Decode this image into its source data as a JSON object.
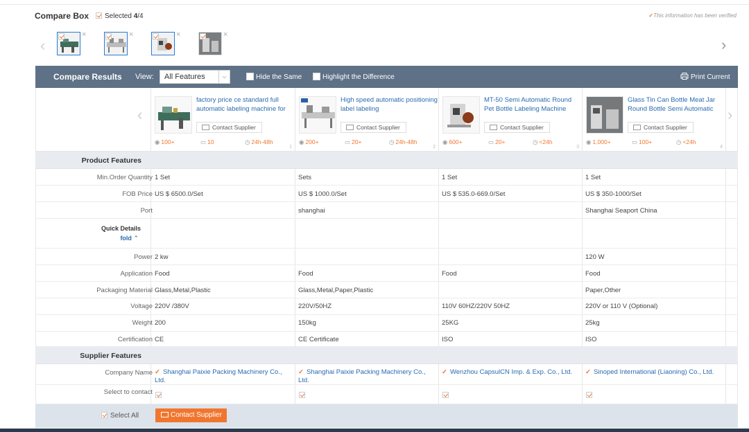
{
  "compare_box": {
    "title": "Compare Box",
    "selected_prefix": "Selected ",
    "selected_count": "4",
    "selected_total": "/4",
    "verified_text": "This information has been verified",
    "thumbs": [
      {
        "close": "×"
      },
      {
        "close": "×"
      },
      {
        "close": "×"
      },
      {
        "close": "×"
      }
    ]
  },
  "toolbar": {
    "title": "Compare Results",
    "view_label": "View:",
    "view_value": "All Features",
    "hide_same": "Hide the Same",
    "highlight_diff": "Highlight the Difference",
    "print": "Print Current"
  },
  "products": [
    {
      "title": "factory price ce standard full automatic labeling machine for",
      "contact": "Contact Supplier",
      "views": "100+",
      "inquiries": "10",
      "response": "24h-48h",
      "num": "1"
    },
    {
      "title": "High speed automatic positioning label labeling",
      "contact": "Contact Supplier",
      "views": "200+",
      "inquiries": "20+",
      "response": "24h-48h",
      "num": "2"
    },
    {
      "title": "MT-50 Semi Automatic Round Pet Bottle Labeling Machine",
      "contact": "Contact Supplier",
      "views": "600+",
      "inquiries": "20+",
      "response": "<24h",
      "num": "3"
    },
    {
      "title": "Glass Tin Can Bottle Meat Jar Round Bottle Semi Automatic",
      "contact": "Contact Supplier",
      "views": "1,000+",
      "inquiries": "100+",
      "response": "<24h",
      "num": "4"
    }
  ],
  "sections": {
    "product_features": "Product Features",
    "supplier_features": "Supplier Features"
  },
  "rows": {
    "moq": {
      "label": "Min.Order Quantity",
      "values": [
        "1 Set",
        "Sets",
        "1 Set",
        "1 Set"
      ]
    },
    "fob": {
      "label": "FOB Price",
      "values": [
        "US $ 6500.0/Set",
        "US $ 1000.0/Set",
        "US $ 535.0-669.0/Set",
        "US $ 350-1000/Set"
      ]
    },
    "port": {
      "label": "Port",
      "values": [
        "",
        "shanghai",
        "",
        "Shanghai Seaport China"
      ]
    },
    "quick_details": {
      "label": "Quick Details",
      "fold": "fold"
    },
    "power": {
      "label": "Power",
      "values": [
        "2 kw",
        "",
        "",
        "120 W"
      ]
    },
    "application": {
      "label": "Application",
      "values": [
        "Food",
        "Food",
        "Food",
        "Food"
      ]
    },
    "packaging": {
      "label": "Packaging Material",
      "values": [
        "Glass,Metal,Plastic",
        "Glass,Metal,Paper,Plastic",
        "",
        "Paper,Other"
      ]
    },
    "voltage": {
      "label": "Voltage",
      "values": [
        "220V /380V",
        "220V/50HZ",
        "110V 60HZ/220V 50HZ",
        "220V or 110 V (Optional)"
      ]
    },
    "weight": {
      "label": "Weight",
      "values": [
        "200",
        "150kg",
        "25KG",
        "25kg"
      ]
    },
    "certification": {
      "label": "Certification",
      "values": [
        "CE",
        "CE Certificate",
        "ISO",
        "ISO"
      ]
    },
    "company": {
      "label": "Company Name",
      "values": [
        "Shanghai Paixie Packing Machinery Co., Ltd.",
        "Shanghai Paixie Packing Machinery Co., Ltd.",
        "Wenzhou CapsulCN Imp. & Exp. Co., Ltd.",
        "Sinoped International (Liaoning) Co., Ltd."
      ]
    },
    "select_contact": {
      "label": "Select to contact"
    }
  },
  "footer": {
    "select_all": "Select All",
    "contact_button": "Contact Supplier"
  },
  "colors": {
    "accent": "#f0762f",
    "bar": "#5e7186",
    "link": "#2a6bb0"
  }
}
